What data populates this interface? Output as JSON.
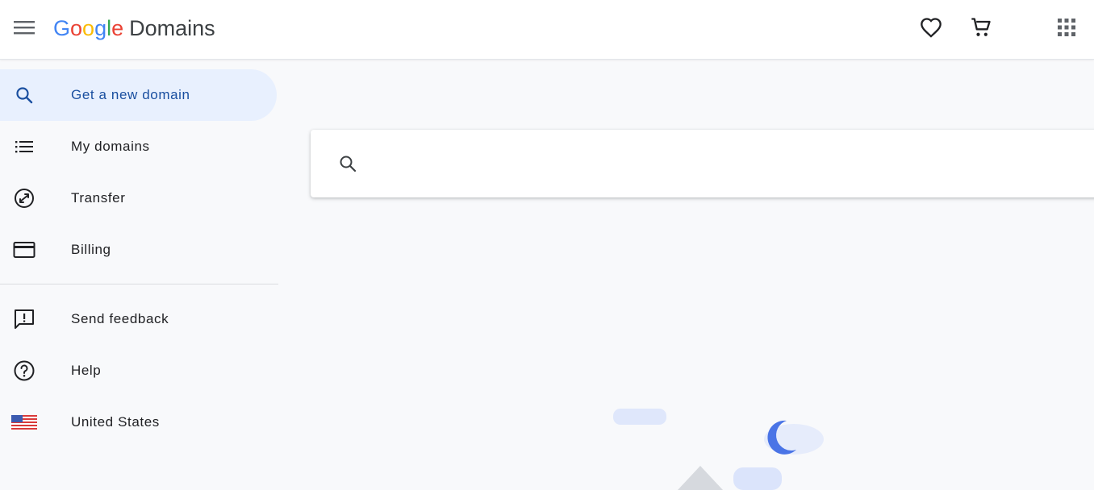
{
  "header": {
    "logo_letters": [
      "G",
      "o",
      "o",
      "g",
      "l",
      "e"
    ],
    "product_name": "Domains",
    "icons": [
      "menu-icon",
      "heart-icon",
      "cart-icon",
      "apps-grid-icon"
    ]
  },
  "sidebar": {
    "items": [
      {
        "label": "Get a new domain",
        "icon": "search-icon",
        "active": true
      },
      {
        "label": "My domains",
        "icon": "list-icon"
      },
      {
        "label": "Transfer",
        "icon": "transfer-icon"
      },
      {
        "label": "Billing",
        "icon": "credit-card-icon"
      },
      {
        "label": "Send feedback",
        "icon": "feedback-icon"
      },
      {
        "label": "Help",
        "icon": "help-icon"
      },
      {
        "label": "United States",
        "icon": "us-flag-icon"
      }
    ]
  },
  "main": {
    "search": {
      "value": "",
      "placeholder": ""
    }
  },
  "colors": {
    "accent": "#1a73e8",
    "active_bg": "#e8f0fe",
    "google_blue": "#4285f4",
    "google_red": "#ea4335",
    "google_yellow": "#fbbc05",
    "google_green": "#34a853"
  }
}
